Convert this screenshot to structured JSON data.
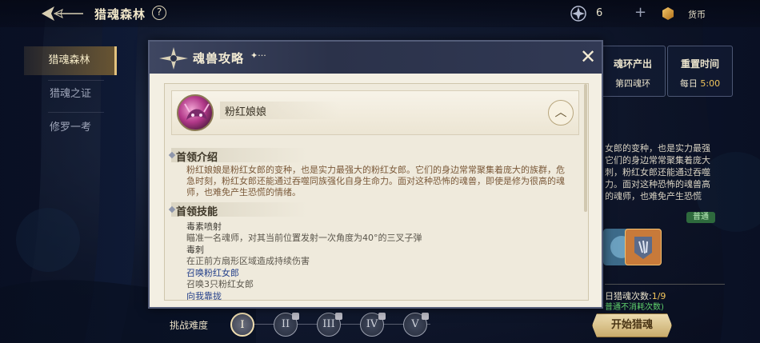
{
  "topbar": {
    "title": "猎魂森林",
    "help": "?",
    "soul_count": "6",
    "plus": "+",
    "currency_label": "货币"
  },
  "sidebar": {
    "items": [
      {
        "label": "猎魂森林",
        "active": true
      },
      {
        "label": "猎魂之证",
        "active": false
      },
      {
        "label": "修罗一考",
        "active": false
      }
    ]
  },
  "info_panel": {
    "ring_title": "魂环产出",
    "ring_value": "第四魂环",
    "reset_title": "重置时间",
    "reset_prefix": "每日",
    "reset_time": "5:00",
    "desc": "女郎的变种，也是实力最强它们的身边常常聚集着庞大刺，粉红女郎还能通过吞噬力。面对这种恐怖的魂兽高的魂师，也难免产生恐慌",
    "badge": "普通",
    "count_prefix": "日猎魂次数:",
    "count_value": "1/9",
    "note": "普通不消耗次数)",
    "start_button": "开始猎魂"
  },
  "difficulty": {
    "label": "挑战难度",
    "levels": [
      "I",
      "II",
      "III",
      "IV",
      "V"
    ]
  },
  "modal": {
    "title": "魂兽攻略",
    "dots": "✦···",
    "close": "✕",
    "boss_name": "粉红娘娘",
    "collapse": "︿",
    "intro_title": "首领介绍",
    "intro_text": "粉红娘娘是粉红女郎的变种，也是实力最强大的粉红女郎。它们的身边常常聚集着庞大的族群，危急时刻，粉红女郎还能通过吞噬同族强化自身生命力。面对这种恐怖的魂兽，即使是修为很高的魂师，也难免产生恐慌的情绪。",
    "skills_title": "首领技能",
    "skills": [
      {
        "name": "毒素喷射",
        "desc": "瞄准一名魂师，对其当前位置发射一次角度为40°的三叉子弹",
        "highlight": false
      },
      {
        "name": "毒刺",
        "desc": "在正前方扇形区域造成持续伤害",
        "highlight": true
      },
      {
        "name": "召唤粉红女郎",
        "desc": "召唤3只粉红女郎",
        "highlight": true
      },
      {
        "name": "向我靠拢",
        "desc": "",
        "highlight": true
      }
    ]
  },
  "icons": {
    "back": "back-arrow-icon",
    "soul": "soul-emblem-icon",
    "coin": "coin-icon",
    "close": "close-icon"
  },
  "colors": {
    "accent_gold": "#e2c27e",
    "modal_header": "#2b324a",
    "modal_body": "#f3efe3",
    "highlight_blue": "#233f8a",
    "time_gold": "#f2c55c"
  }
}
